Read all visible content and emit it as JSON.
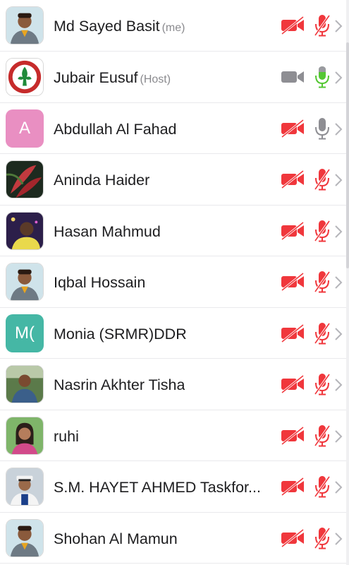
{
  "participants": [
    {
      "name": "Md Sayed Basit",
      "role": "(me)",
      "avatar": {
        "kind": "photo",
        "icon": "scout-portrait"
      },
      "video": "off",
      "mic": "muted"
    },
    {
      "name": "Jubair Eusuf",
      "role": "(Host)",
      "avatar": {
        "kind": "photo",
        "icon": "scout-emblem"
      },
      "video": "on",
      "mic": "active"
    },
    {
      "name": "Abdullah  Al Fahad",
      "role": "",
      "avatar": {
        "kind": "letter",
        "text": "A",
        "color": "#e98fc2"
      },
      "video": "off",
      "mic": "unmuted"
    },
    {
      "name": "Aninda Haider",
      "role": "",
      "avatar": {
        "kind": "photo",
        "icon": "red-leaf-photo"
      },
      "video": "off",
      "mic": "muted"
    },
    {
      "name": "Hasan Mahmud",
      "role": "",
      "avatar": {
        "kind": "photo",
        "icon": "night-portrait"
      },
      "video": "off",
      "mic": "muted"
    },
    {
      "name": "Iqbal Hossain",
      "role": "",
      "avatar": {
        "kind": "photo",
        "icon": "scout-portrait"
      },
      "video": "off",
      "mic": "muted"
    },
    {
      "name": "Monia (SRMR)DDR",
      "role": "",
      "avatar": {
        "kind": "letter",
        "text": "M(",
        "color": "#45b7a5"
      },
      "video": "off",
      "mic": "muted"
    },
    {
      "name": "Nasrin Akhter Tisha",
      "role": "",
      "avatar": {
        "kind": "photo",
        "icon": "outdoor-portrait"
      },
      "video": "off",
      "mic": "muted"
    },
    {
      "name": "ruhi",
      "role": "",
      "avatar": {
        "kind": "photo",
        "icon": "green-portrait"
      },
      "video": "off",
      "mic": "muted"
    },
    {
      "name": "S.M. HAYET AHMED Taskfor...",
      "role": "",
      "avatar": {
        "kind": "photo",
        "icon": "cap-portrait"
      },
      "video": "off",
      "mic": "muted"
    },
    {
      "name": "Shohan Al Mamun",
      "role": "",
      "avatar": {
        "kind": "photo",
        "icon": "scout-portrait"
      },
      "video": "off",
      "mic": "muted"
    }
  ],
  "colors": {
    "muted_red": "#f0373c",
    "active_green": "#55c734",
    "neutral_gray": "#8e8e93",
    "chevron": "#b5b5ba"
  },
  "icons": {
    "video_off": "video-off-icon",
    "video_on": "video-icon",
    "mic_muted": "mic-muted-icon",
    "mic_active": "mic-icon",
    "chevron": "chevron-right-icon"
  }
}
